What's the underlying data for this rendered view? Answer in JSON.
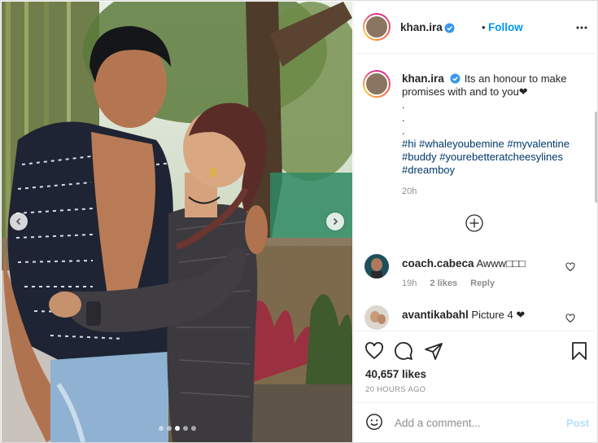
{
  "post": {
    "username": "khan.ira",
    "follow_label": "Follow",
    "bullet": "•",
    "verified": true,
    "carousel": {
      "count": 5,
      "active_index": 2
    }
  },
  "caption": {
    "username": "khan.ira",
    "text_line1": "Its an honour to make",
    "text_line2": "promises with and to you❤",
    "dots": [
      ".",
      ".",
      "."
    ],
    "hashtags_line1": "#hi #whaleyoubemine #myvalentine",
    "hashtags_line2": "#buddy #yourebetteratcheesylines",
    "hashtags_line3": "#dreamboy",
    "time": "20h"
  },
  "comments": [
    {
      "username": "coach.cabeca",
      "text": "Awww□□□",
      "time": "19h",
      "likes": "2 likes",
      "reply": "Reply"
    },
    {
      "username": "avantikabahl",
      "text": "Picture 4 ❤"
    }
  ],
  "stats": {
    "likes": "40,657 likes",
    "posted": "20 HOURS AGO"
  },
  "add_comment": {
    "placeholder": "Add a comment...",
    "post_label": "Post"
  },
  "icons": {
    "heart": "heart-icon",
    "comment": "comment-icon",
    "share": "share-icon",
    "save": "bookmark-icon",
    "emoji": "emoji-icon",
    "more": "more-options-icon",
    "load_more": "load-more-icon",
    "verified": "verified-badge-icon",
    "prev": "chevron-left-icon",
    "next": "chevron-right-icon"
  },
  "colors": {
    "link_blue": "#0095f6",
    "hashtag": "#00376b",
    "muted": "#8e8e8e",
    "post_disabled": "#b2dffc"
  }
}
